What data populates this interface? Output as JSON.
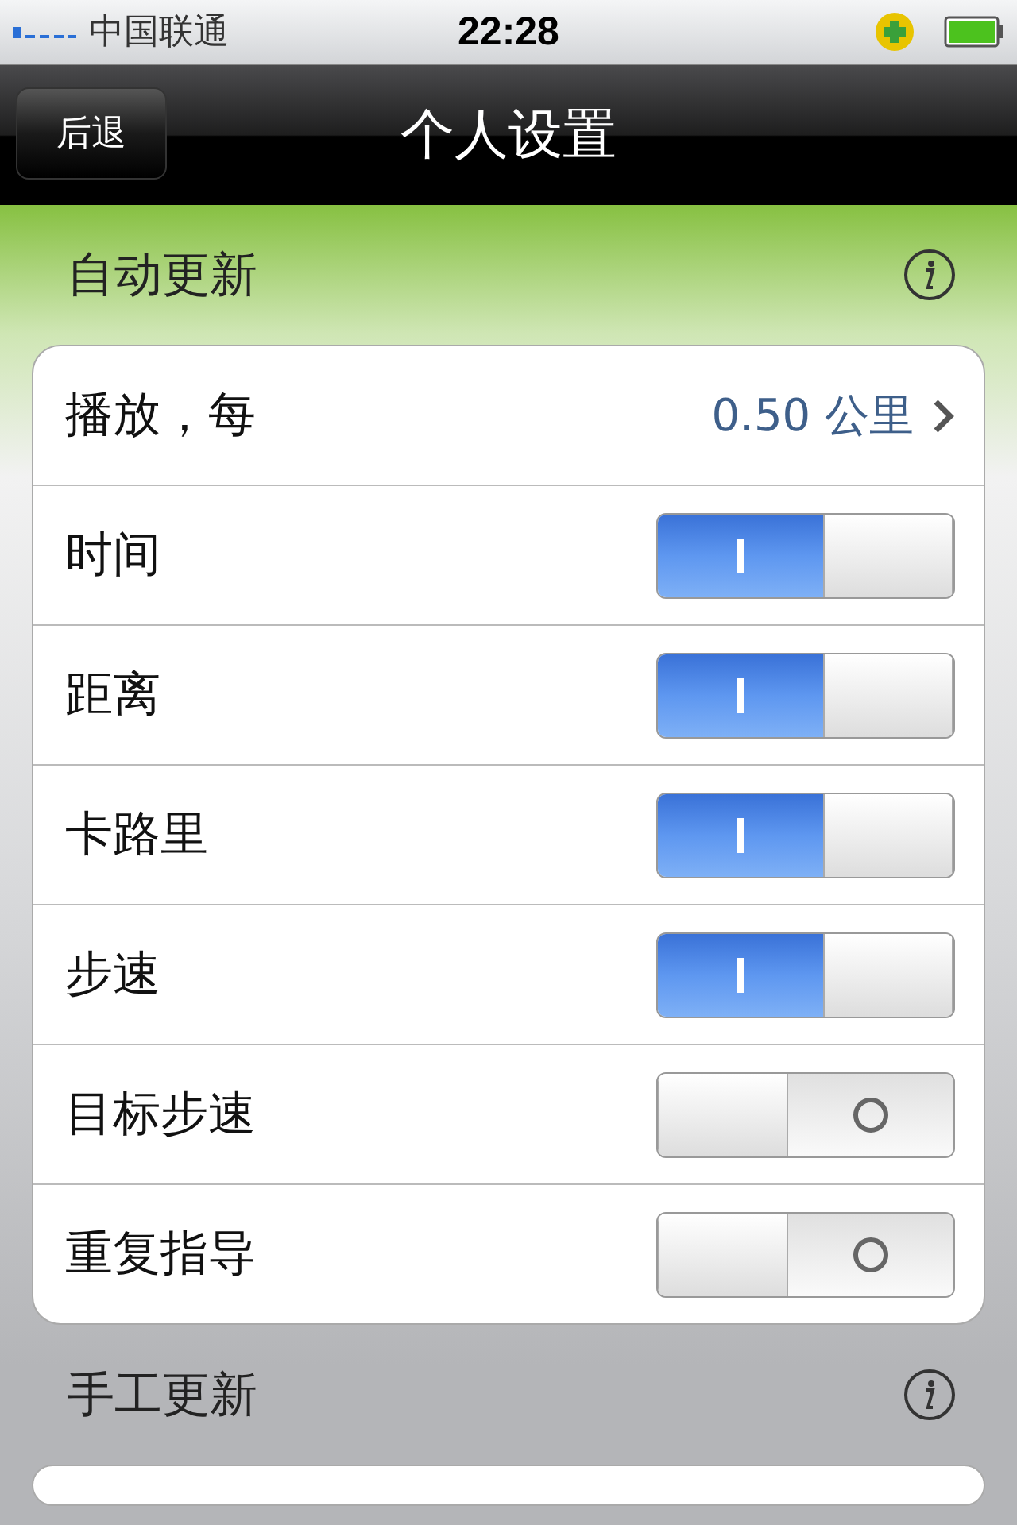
{
  "status_bar": {
    "carrier": "中国联通",
    "time": "22:28"
  },
  "nav_bar": {
    "back": "后退",
    "title": "个人设置"
  },
  "sections": [
    {
      "title": "自动更新",
      "rows": [
        {
          "kind": "value",
          "label": "播放，每",
          "value": "0.50 公里"
        },
        {
          "kind": "toggle",
          "label": "时间",
          "on": true
        },
        {
          "kind": "toggle",
          "label": "距离",
          "on": true
        },
        {
          "kind": "toggle",
          "label": "卡路里",
          "on": true
        },
        {
          "kind": "toggle",
          "label": "步速",
          "on": true
        },
        {
          "kind": "toggle",
          "label": "目标步速",
          "on": false
        },
        {
          "kind": "toggle",
          "label": "重复指导",
          "on": false
        }
      ]
    },
    {
      "title": "手工更新"
    }
  ]
}
